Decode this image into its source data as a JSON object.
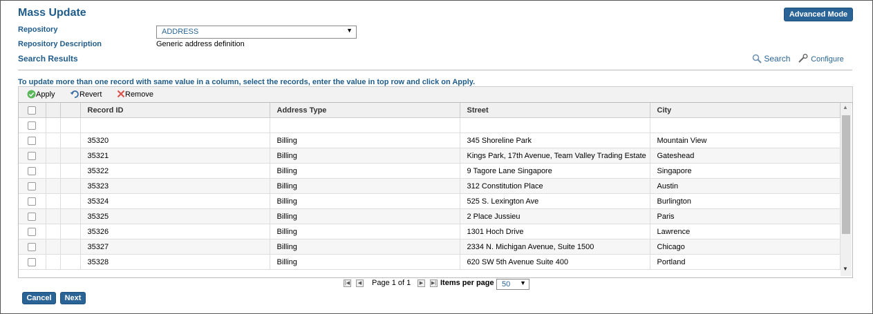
{
  "header": {
    "title": "Mass Update",
    "advanced_mode_label": "Advanced Mode"
  },
  "form": {
    "repository_label": "Repository",
    "repository_value": "ADDRESS",
    "repository_description_label": "Repository Description",
    "repository_description_value": "Generic address definition"
  },
  "results": {
    "title": "Search Results",
    "search_label": "Search",
    "configure_label": "Configure",
    "instruction": "To update more than one record with same value in a column, select the records, enter the value in top row and click on Apply."
  },
  "toolbar": {
    "apply_label": "Apply",
    "revert_label": "Revert",
    "remove_label": "Remove"
  },
  "table": {
    "columns": [
      "Record ID",
      "Address Type",
      "Street",
      "City"
    ],
    "rows": [
      [
        "35320",
        "Billing",
        "345 Shoreline Park",
        "Mountain View"
      ],
      [
        "35321",
        "Billing",
        "Kings Park, 17th Avenue, Team Valley Trading Estate",
        "Gateshead"
      ],
      [
        "35322",
        "Billing",
        "9 Tagore Lane Singapore",
        "Singapore"
      ],
      [
        "35323",
        "Billing",
        "312 Constitution Place",
        "Austin"
      ],
      [
        "35324",
        "Billing",
        "525 S. Lexington Ave",
        "Burlington"
      ],
      [
        "35325",
        "Billing",
        "2 Place Jussieu",
        "Paris"
      ],
      [
        "35326",
        "Billing",
        "1301 Hoch Drive",
        "Lawrence"
      ],
      [
        "35327",
        "Billing",
        "2334 N. Michigan Avenue, Suite 1500",
        "Chicago"
      ],
      [
        "35328",
        "Billing",
        "620 SW 5th Avenue Suite 400",
        "Portland"
      ]
    ]
  },
  "pager": {
    "page_text": "Page 1 of 1",
    "items_per_page_label": "Items per page",
    "items_per_page_value": "50"
  },
  "footer": {
    "cancel_label": "Cancel",
    "next_label": "Next"
  },
  "colors": {
    "accent": "#1f5c8b",
    "button": "#2a6496"
  }
}
